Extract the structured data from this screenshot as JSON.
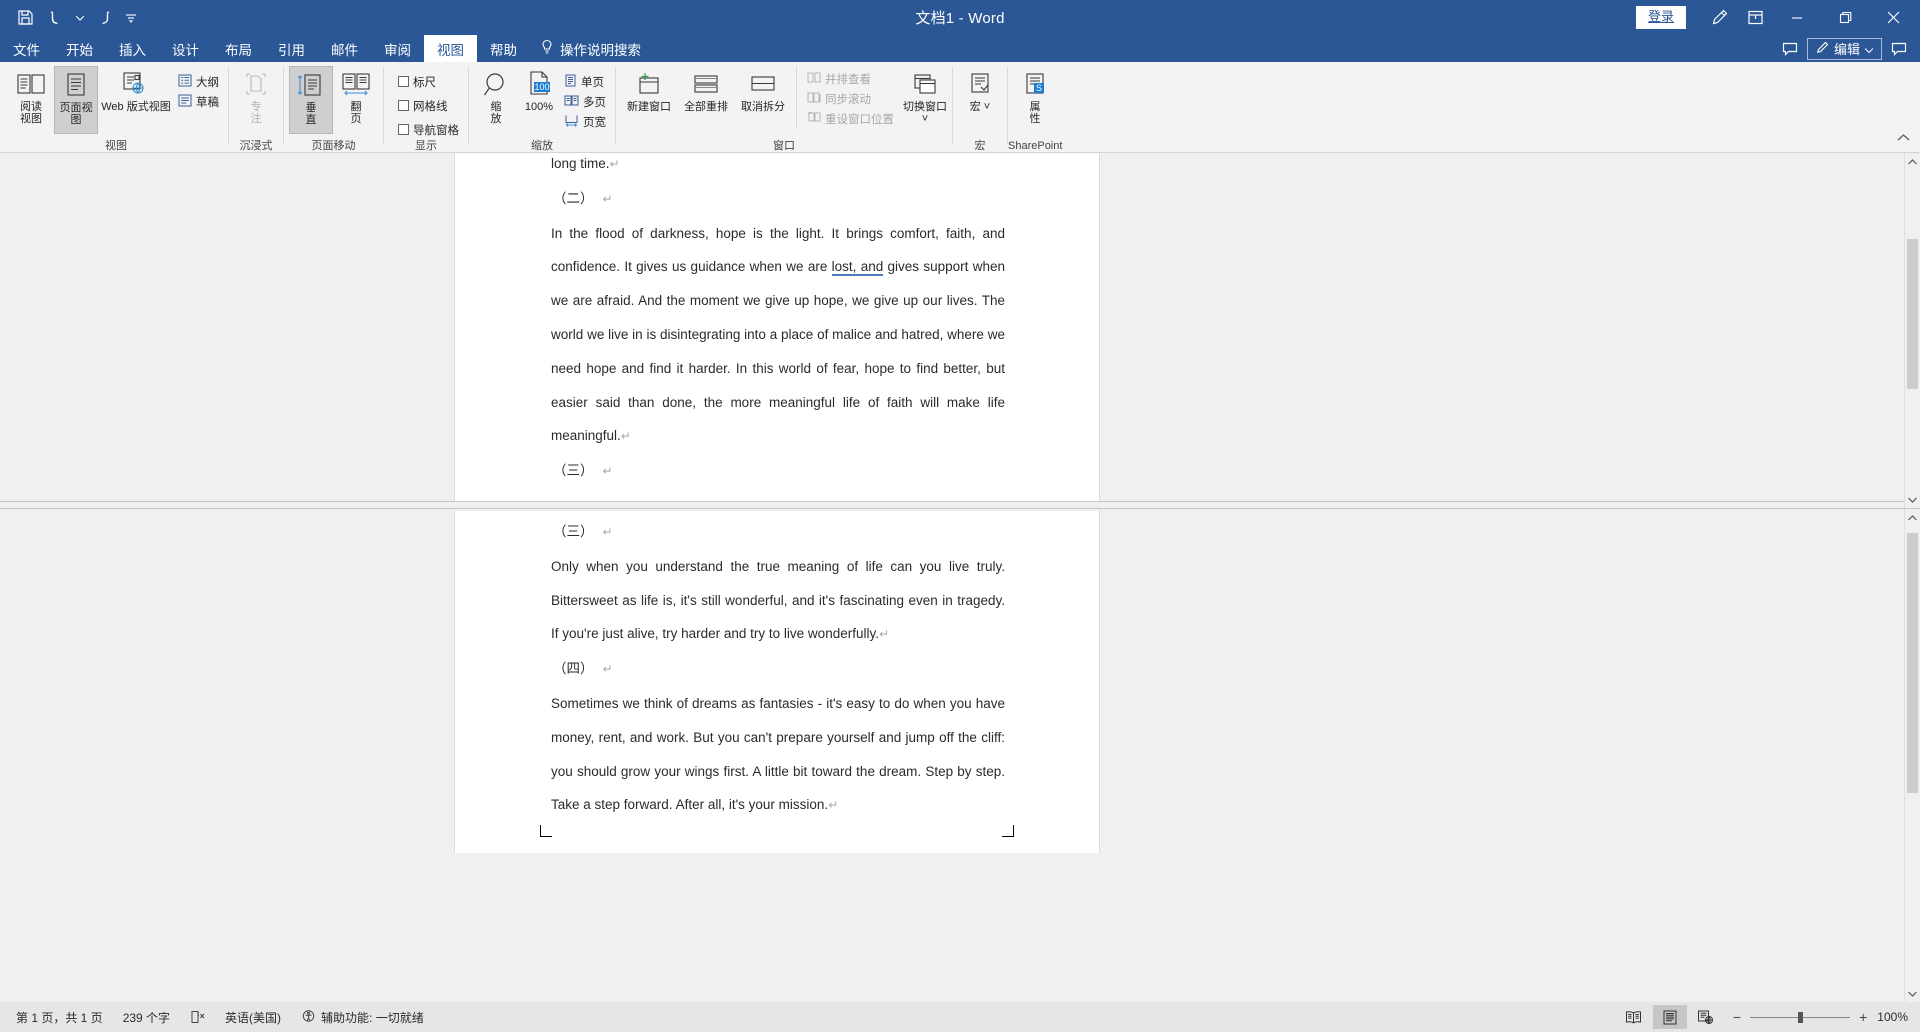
{
  "titlebar": {
    "document_title": "文档1",
    "app_name": "Word",
    "title_full": "文档1  -  Word",
    "quick_access": [
      {
        "name": "save-icon",
        "label": "保存"
      },
      {
        "name": "undo-icon",
        "label": "撤消"
      },
      {
        "name": "undo-dropdown-icon",
        "label": "撤消下拉"
      },
      {
        "name": "redo-icon",
        "label": "恢复"
      },
      {
        "name": "customize-qat-icon",
        "label": "自定义快速访问工具栏"
      }
    ],
    "sign_in": "登录",
    "ink_icon": "pen-icon",
    "ribbon_display_icon": "ribbon-display-options-icon",
    "minimize": "—",
    "restore": "❐",
    "close": "✕"
  },
  "tabs": [
    {
      "label": "文件",
      "active": false
    },
    {
      "label": "开始",
      "active": false
    },
    {
      "label": "插入",
      "active": false
    },
    {
      "label": "设计",
      "active": false
    },
    {
      "label": "布局",
      "active": false
    },
    {
      "label": "引用",
      "active": false
    },
    {
      "label": "邮件",
      "active": false
    },
    {
      "label": "审阅",
      "active": false
    },
    {
      "label": "视图",
      "active": true
    },
    {
      "label": "帮助",
      "active": false
    }
  ],
  "tell_me": "操作说明搜索",
  "edit_button": "编辑",
  "ribbon": {
    "groups": [
      {
        "label": "视图",
        "items": [
          {
            "name": "read-mode-button",
            "label": "阅读\n视图",
            "icon": "read-mode-icon",
            "state": "normal"
          },
          {
            "name": "print-layout-button",
            "label": "页面视图",
            "icon": "print-layout-icon",
            "state": "selected"
          },
          {
            "name": "web-layout-button",
            "label": "Web 版式视图",
            "icon": "web-layout-icon",
            "state": "normal"
          },
          {
            "name": "outline-button",
            "label": "大纲",
            "icon": "outline-icon",
            "state": "normal"
          },
          {
            "name": "draft-button",
            "label": "草稿",
            "icon": "draft-icon",
            "state": "normal"
          }
        ]
      },
      {
        "label": "沉浸式",
        "items": [
          {
            "name": "focus-button",
            "label": "专\n注",
            "icon": "focus-icon",
            "state": "disabled"
          }
        ]
      },
      {
        "label": "页面移动",
        "items": [
          {
            "name": "vertical-scroll-button",
            "label": "垂\n直",
            "icon": "vertical-icon",
            "state": "selected"
          },
          {
            "name": "side-to-side-button",
            "label": "翻\n页",
            "icon": "side-to-side-icon",
            "state": "normal"
          }
        ]
      },
      {
        "label": "显示",
        "items": [
          {
            "name": "ruler-checkbox",
            "label": "标尺",
            "checked": false
          },
          {
            "name": "gridlines-checkbox",
            "label": "网格线",
            "checked": false
          },
          {
            "name": "navigation-pane-checkbox",
            "label": "导航窗格",
            "checked": false
          }
        ]
      },
      {
        "label": "缩放",
        "items": [
          {
            "name": "zoom-button",
            "label": "缩\n放",
            "icon": "magnifier-icon"
          },
          {
            "name": "zoom-100-button",
            "label": "100%",
            "icon": "zoom-100-icon",
            "badge": "100"
          },
          {
            "name": "one-page-button",
            "label": "单页",
            "icon": "one-page-icon"
          },
          {
            "name": "multiple-pages-button",
            "label": "多页",
            "icon": "multi-page-icon"
          },
          {
            "name": "page-width-button",
            "label": "页宽",
            "icon": "page-width-icon"
          }
        ]
      },
      {
        "label": "窗口",
        "items": [
          {
            "name": "new-window-button",
            "label": "新建窗口",
            "icon": "new-window-icon",
            "state": "normal"
          },
          {
            "name": "arrange-all-button",
            "label": "全部重排",
            "icon": "arrange-all-icon",
            "state": "normal"
          },
          {
            "name": "remove-split-button",
            "label": "取消拆分",
            "icon": "split-icon",
            "state": "normal"
          },
          {
            "name": "view-side-by-side-button",
            "label": "并排查看",
            "state": "disabled"
          },
          {
            "name": "synchronous-scrolling-button",
            "label": "同步滚动",
            "state": "disabled"
          },
          {
            "name": "reset-window-position-button",
            "label": "重设窗口位置",
            "state": "disabled"
          },
          {
            "name": "switch-windows-button",
            "label": "切换窗口",
            "icon": "switch-windows-icon",
            "state": "normal"
          }
        ]
      },
      {
        "label": "宏",
        "items": [
          {
            "name": "macros-button",
            "label": "宏",
            "icon": "macros-icon"
          }
        ]
      },
      {
        "label": "SharePoint",
        "items": [
          {
            "name": "properties-button",
            "label": "属\n性",
            "icon": "sharepoint-properties-icon"
          }
        ]
      }
    ],
    "collapse_icon": "chevron-up-icon"
  },
  "document": {
    "page1": {
      "blocks": [
        {
          "type": "para",
          "text": "long time.",
          "mark": "↵"
        },
        {
          "type": "heading",
          "text": "（二）",
          "mark": "↵"
        },
        {
          "type": "para",
          "text": "In the flood of darkness, hope is the light. It brings comfort, faith, and confidence. It gives us guidance when we are ",
          "err": "lost, and",
          "text2": " gives support when we are afraid. And the moment we give up hope, we give up our lives. The world we live in is disintegrating into a place of malice and hatred, where we need hope and find it harder. In this world of fear, hope to find better, but easier said than done, the more meaningful life of faith will make life meaningful.",
          "mark": "↵"
        },
        {
          "type": "heading",
          "text": "（三）",
          "mark": "↵"
        }
      ]
    },
    "page2": {
      "blocks": [
        {
          "type": "heading",
          "text": "（三）",
          "mark": "↵"
        },
        {
          "type": "para",
          "text": "Only when you understand the true meaning of life can you live truly. Bittersweet as life is, it's still wonderful, and it's fascinating even in tragedy. If you're just alive, try harder and try to live wonderfully.",
          "mark": "↵"
        },
        {
          "type": "heading",
          "text": "（四）",
          "mark": "↵"
        },
        {
          "type": "para",
          "text": "Sometimes we think of dreams as fantasies - it's easy to do when you have money, rent, and work. But you can't prepare yourself and jump off the cliff: you should grow your wings first. A little bit toward the dream. Step by step. Take a step forward. After all, it's your mission.",
          "mark": "↵"
        }
      ]
    }
  },
  "statusbar": {
    "page_info": "第 1 页，共 1 页",
    "word_count": "239 个字",
    "proofing_icon": "proofing-errors-icon",
    "language": "英语(美国)",
    "accessibility": "辅助功能: 一切就绪",
    "views": [
      {
        "name": "read-mode-view-button",
        "icon": "read-mode-icon",
        "active": false
      },
      {
        "name": "print-layout-view-button",
        "icon": "print-layout-icon",
        "active": true
      },
      {
        "name": "web-layout-view-button",
        "icon": "web-layout-icon",
        "active": false
      }
    ],
    "zoom_out": "−",
    "zoom_in": "+",
    "zoom_level": "100%"
  },
  "colors": {
    "title_blue": "#2b5797",
    "ribbon_bg": "#f3f3f3",
    "status_bg": "#e6e6e6",
    "doc_bg": "#f0f0f0",
    "spell_underline": "#4a7ebb"
  }
}
